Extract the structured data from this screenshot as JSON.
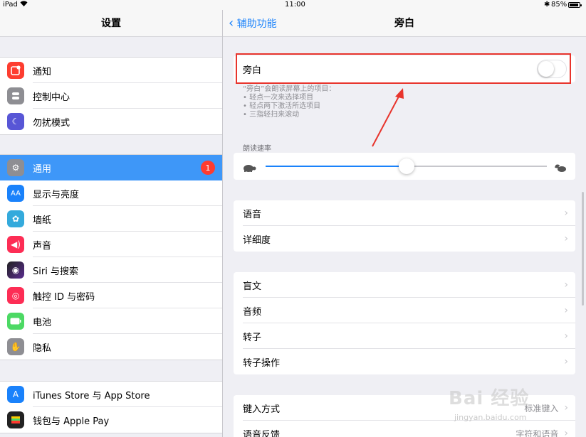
{
  "status": {
    "carrier": "iPad",
    "time": "11:00",
    "battery": "85%"
  },
  "left": {
    "title": "设置",
    "group1": [
      {
        "label": "通知",
        "icon": "notification-icon",
        "color": "#fd3d30"
      },
      {
        "label": "控制中心",
        "icon": "control-center-icon",
        "color": "#8e8e93"
      },
      {
        "label": "勿扰模式",
        "icon": "moon-icon",
        "color": "#5856d6"
      }
    ],
    "group2": [
      {
        "label": "通用",
        "icon": "gear-icon",
        "color": "#8e8e93",
        "badge": "1",
        "selected": true
      },
      {
        "label": "显示与亮度",
        "icon": "display-icon",
        "color": "#1a82fb"
      },
      {
        "label": "墙纸",
        "icon": "wallpaper-icon",
        "color": "#34aadc"
      },
      {
        "label": "声音",
        "icon": "sound-icon",
        "color": "#fd2d55"
      },
      {
        "label": "Siri 与搜索",
        "icon": "siri-icon",
        "color": "#222222"
      },
      {
        "label": "触控 ID 与密码",
        "icon": "fingerprint-icon",
        "color": "#fd2d55"
      },
      {
        "label": "电池",
        "icon": "battery-icon",
        "color": "#4cd964"
      },
      {
        "label": "隐私",
        "icon": "hand-icon",
        "color": "#8e8e93"
      }
    ],
    "group3": [
      {
        "label": "iTunes Store 与 App Store",
        "icon": "app-store-icon",
        "color": "#1a82fb"
      },
      {
        "label": "钱包与 Apple Pay",
        "icon": "wallet-icon",
        "color": "#222222"
      }
    ]
  },
  "right": {
    "back": "辅助功能",
    "title": "旁白",
    "voiceover_label": "旁白",
    "voiceover_on": false,
    "hint": [
      "“旁白”会朗读屏幕上的项目：",
      "• 轻点一次来选择项目",
      "• 轻点两下激活所选项目",
      "• 三指轻扫来滚动"
    ],
    "rate_label": "朗读速率",
    "rate_value": 0.5,
    "group_a": [
      {
        "label": "语音"
      },
      {
        "label": "详细度"
      }
    ],
    "group_b": [
      {
        "label": "盲文"
      },
      {
        "label": "音频"
      },
      {
        "label": "转子"
      },
      {
        "label": "转子操作"
      }
    ],
    "group_c": [
      {
        "label": "键入方式",
        "value": "标准键入"
      },
      {
        "label": "语音反馈",
        "value": "字符和语音"
      }
    ]
  },
  "watermark": {
    "main": "Bai 经验",
    "sub": "jingyan.baidu.com"
  },
  "colors": {
    "accent": "#1a82fb",
    "selected": "#3e97f8",
    "annotation": "#e8342c"
  }
}
